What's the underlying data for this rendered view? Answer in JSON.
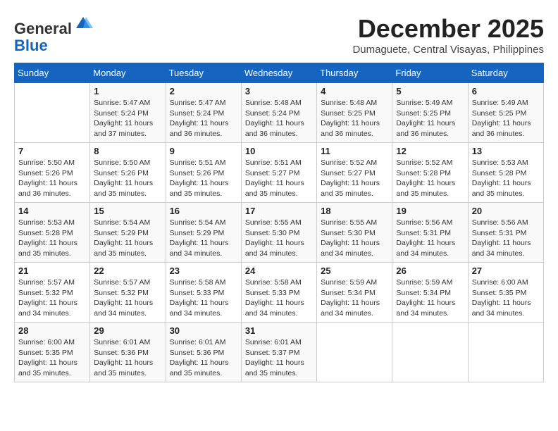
{
  "header": {
    "logo_line1": "General",
    "logo_line2": "Blue",
    "title": "December 2025",
    "location": "Dumaguete, Central Visayas, Philippines"
  },
  "days_of_week": [
    "Sunday",
    "Monday",
    "Tuesday",
    "Wednesday",
    "Thursday",
    "Friday",
    "Saturday"
  ],
  "weeks": [
    [
      {
        "day": "",
        "info": ""
      },
      {
        "day": "1",
        "info": "Sunrise: 5:47 AM\nSunset: 5:24 PM\nDaylight: 11 hours\nand 37 minutes."
      },
      {
        "day": "2",
        "info": "Sunrise: 5:47 AM\nSunset: 5:24 PM\nDaylight: 11 hours\nand 36 minutes."
      },
      {
        "day": "3",
        "info": "Sunrise: 5:48 AM\nSunset: 5:24 PM\nDaylight: 11 hours\nand 36 minutes."
      },
      {
        "day": "4",
        "info": "Sunrise: 5:48 AM\nSunset: 5:25 PM\nDaylight: 11 hours\nand 36 minutes."
      },
      {
        "day": "5",
        "info": "Sunrise: 5:49 AM\nSunset: 5:25 PM\nDaylight: 11 hours\nand 36 minutes."
      },
      {
        "day": "6",
        "info": "Sunrise: 5:49 AM\nSunset: 5:25 PM\nDaylight: 11 hours\nand 36 minutes."
      }
    ],
    [
      {
        "day": "7",
        "info": "Sunrise: 5:50 AM\nSunset: 5:26 PM\nDaylight: 11 hours\nand 36 minutes."
      },
      {
        "day": "8",
        "info": "Sunrise: 5:50 AM\nSunset: 5:26 PM\nDaylight: 11 hours\nand 35 minutes."
      },
      {
        "day": "9",
        "info": "Sunrise: 5:51 AM\nSunset: 5:26 PM\nDaylight: 11 hours\nand 35 minutes."
      },
      {
        "day": "10",
        "info": "Sunrise: 5:51 AM\nSunset: 5:27 PM\nDaylight: 11 hours\nand 35 minutes."
      },
      {
        "day": "11",
        "info": "Sunrise: 5:52 AM\nSunset: 5:27 PM\nDaylight: 11 hours\nand 35 minutes."
      },
      {
        "day": "12",
        "info": "Sunrise: 5:52 AM\nSunset: 5:28 PM\nDaylight: 11 hours\nand 35 minutes."
      },
      {
        "day": "13",
        "info": "Sunrise: 5:53 AM\nSunset: 5:28 PM\nDaylight: 11 hours\nand 35 minutes."
      }
    ],
    [
      {
        "day": "14",
        "info": "Sunrise: 5:53 AM\nSunset: 5:28 PM\nDaylight: 11 hours\nand 35 minutes."
      },
      {
        "day": "15",
        "info": "Sunrise: 5:54 AM\nSunset: 5:29 PM\nDaylight: 11 hours\nand 35 minutes."
      },
      {
        "day": "16",
        "info": "Sunrise: 5:54 AM\nSunset: 5:29 PM\nDaylight: 11 hours\nand 34 minutes."
      },
      {
        "day": "17",
        "info": "Sunrise: 5:55 AM\nSunset: 5:30 PM\nDaylight: 11 hours\nand 34 minutes."
      },
      {
        "day": "18",
        "info": "Sunrise: 5:55 AM\nSunset: 5:30 PM\nDaylight: 11 hours\nand 34 minutes."
      },
      {
        "day": "19",
        "info": "Sunrise: 5:56 AM\nSunset: 5:31 PM\nDaylight: 11 hours\nand 34 minutes."
      },
      {
        "day": "20",
        "info": "Sunrise: 5:56 AM\nSunset: 5:31 PM\nDaylight: 11 hours\nand 34 minutes."
      }
    ],
    [
      {
        "day": "21",
        "info": "Sunrise: 5:57 AM\nSunset: 5:32 PM\nDaylight: 11 hours\nand 34 minutes."
      },
      {
        "day": "22",
        "info": "Sunrise: 5:57 AM\nSunset: 5:32 PM\nDaylight: 11 hours\nand 34 minutes."
      },
      {
        "day": "23",
        "info": "Sunrise: 5:58 AM\nSunset: 5:33 PM\nDaylight: 11 hours\nand 34 minutes."
      },
      {
        "day": "24",
        "info": "Sunrise: 5:58 AM\nSunset: 5:33 PM\nDaylight: 11 hours\nand 34 minutes."
      },
      {
        "day": "25",
        "info": "Sunrise: 5:59 AM\nSunset: 5:34 PM\nDaylight: 11 hours\nand 34 minutes."
      },
      {
        "day": "26",
        "info": "Sunrise: 5:59 AM\nSunset: 5:34 PM\nDaylight: 11 hours\nand 34 minutes."
      },
      {
        "day": "27",
        "info": "Sunrise: 6:00 AM\nSunset: 5:35 PM\nDaylight: 11 hours\nand 34 minutes."
      }
    ],
    [
      {
        "day": "28",
        "info": "Sunrise: 6:00 AM\nSunset: 5:35 PM\nDaylight: 11 hours\nand 35 minutes."
      },
      {
        "day": "29",
        "info": "Sunrise: 6:01 AM\nSunset: 5:36 PM\nDaylight: 11 hours\nand 35 minutes."
      },
      {
        "day": "30",
        "info": "Sunrise: 6:01 AM\nSunset: 5:36 PM\nDaylight: 11 hours\nand 35 minutes."
      },
      {
        "day": "31",
        "info": "Sunrise: 6:01 AM\nSunset: 5:37 PM\nDaylight: 11 hours\nand 35 minutes."
      },
      {
        "day": "",
        "info": ""
      },
      {
        "day": "",
        "info": ""
      },
      {
        "day": "",
        "info": ""
      }
    ]
  ]
}
